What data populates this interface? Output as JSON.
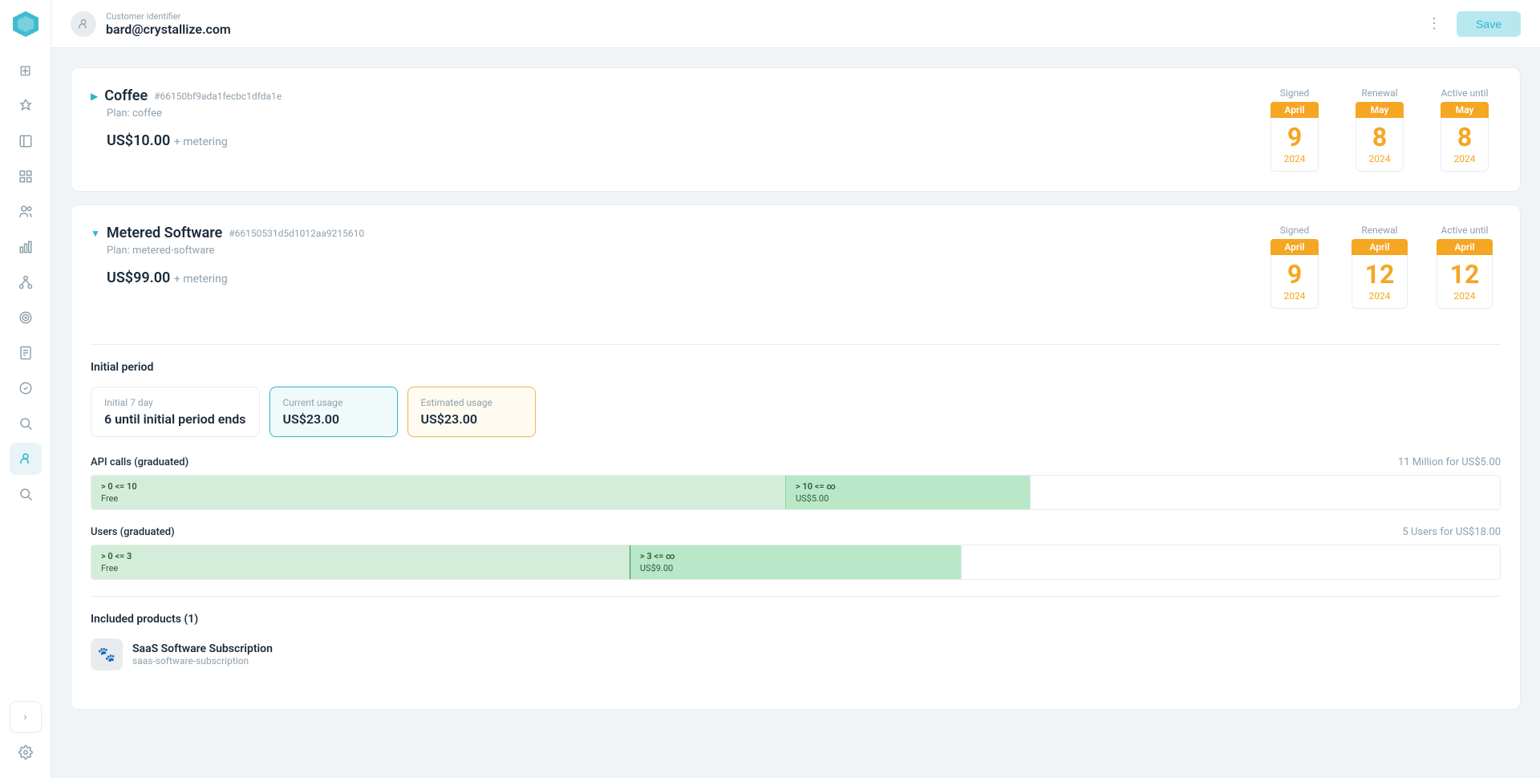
{
  "header": {
    "customer_label": "Customer identifier",
    "customer_email": "bard@crystallize.com",
    "save_button": "Save",
    "more_icon": "⋮"
  },
  "sidebar": {
    "icons": [
      {
        "name": "dashboard",
        "symbol": "⊞",
        "active": false
      },
      {
        "name": "rocket",
        "symbol": "🚀",
        "active": false
      },
      {
        "name": "book",
        "symbol": "📖",
        "active": false
      },
      {
        "name": "grid",
        "symbol": "⬡",
        "active": false
      },
      {
        "name": "users-group",
        "symbol": "👥",
        "active": false
      },
      {
        "name": "chart",
        "symbol": "📊",
        "active": false
      },
      {
        "name": "org",
        "symbol": "🔗",
        "active": false
      },
      {
        "name": "target",
        "symbol": "🎯",
        "active": false
      },
      {
        "name": "doc",
        "symbol": "📄",
        "active": false
      },
      {
        "name": "badge",
        "symbol": "🏷",
        "active": false
      },
      {
        "name": "search",
        "symbol": "🔍",
        "active": false
      },
      {
        "name": "customer-active",
        "symbol": "👤",
        "active": true
      },
      {
        "name": "subscriptions",
        "symbol": "🔁",
        "active": false
      },
      {
        "name": "settings",
        "symbol": "⚙️",
        "active": false
      }
    ],
    "expand_icon": "›"
  },
  "subscriptions": [
    {
      "id": "coffee-sub",
      "name": "Coffee",
      "hash": "#66150bf9ada1fecbc1dfda1e",
      "plan": "Plan: coffee",
      "price": "US$10.00",
      "metering": "+ metering",
      "collapsed": true,
      "signed": {
        "month": "April",
        "day": "9",
        "year": "2024"
      },
      "renewal": {
        "month": "May",
        "day": "8",
        "year": "2024"
      },
      "active_until": {
        "month": "May",
        "day": "8",
        "year": "2024"
      }
    },
    {
      "id": "metered-software-sub",
      "name": "Metered Software",
      "hash": "#66150531d5d1012aa9215610",
      "plan": "Plan: metered-software",
      "price": "US$99.00",
      "metering": "+ metering",
      "collapsed": false,
      "signed": {
        "month": "April",
        "day": "9",
        "year": "2024"
      },
      "renewal": {
        "month": "April",
        "day": "12",
        "year": "2024"
      },
      "active_until": {
        "month": "April",
        "day": "12",
        "year": "2024"
      },
      "period": {
        "title": "Initial period",
        "initial_label": "Initial 7 day",
        "initial_value": "6 until initial period ends",
        "current_label": "Current usage",
        "current_value": "US$23.00",
        "estimated_label": "Estimated usage",
        "estimated_value": "US$23.00"
      },
      "usage_sections": [
        {
          "title": "API calls (graduated)",
          "summary": "11 Million for US$5.00",
          "segments": [
            {
              "range": "> 0 <= 10",
              "price": "Free",
              "type": "free",
              "flex": 3
            },
            {
              "range": "> 10 <= ∞",
              "price": "US$5.00",
              "type": "paid",
              "flex": 1
            },
            {
              "range": "",
              "price": "",
              "type": "empty",
              "flex": 2
            }
          ]
        },
        {
          "title": "Users (graduated)",
          "summary": "5 Users for US$18.00",
          "segments": [
            {
              "range": "> 0 <= 3",
              "price": "Free",
              "type": "free",
              "flex": 2
            },
            {
              "range": "> 3 <= ∞",
              "price": "US$9.00",
              "type": "paid",
              "flex": 1.2
            },
            {
              "range": "",
              "price": "",
              "type": "empty",
              "flex": 2
            }
          ]
        }
      ],
      "included_products": {
        "title": "Included products (1)",
        "items": [
          {
            "name": "SaaS Software Subscription",
            "slug": "saas-software-subscription",
            "icon": "🐾"
          }
        ]
      }
    }
  ]
}
